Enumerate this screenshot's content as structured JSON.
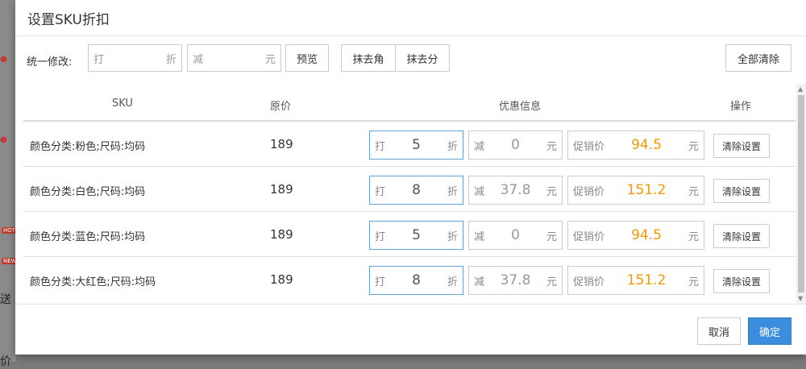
{
  "background": {
    "badge_hot": "HOT",
    "badge_new": "NEW",
    "text_song": "送",
    "text_jia": "价"
  },
  "modal": {
    "title": "设置SKU折扣"
  },
  "toolbar": {
    "label": "统一修改:",
    "discount_placeholder": "打",
    "discount_unit": "折",
    "reduce_placeholder": "减",
    "reduce_unit": "元",
    "preview_label": "预览",
    "round_jiao_label": "抹去角",
    "round_fen_label": "抹去分",
    "clear_all_label": "全部清除"
  },
  "table": {
    "headers": {
      "sku": "SKU",
      "price": "原价",
      "discount": "优惠信息",
      "ops": "操作"
    },
    "discount_prefix": "打",
    "discount_unit": "折",
    "reduce_prefix": "减",
    "reduce_unit": "元",
    "promo_prefix": "促销价",
    "promo_unit": "元",
    "clear_label": "清除设置",
    "rows": [
      {
        "sku": "颜色分类:粉色;尺码:均码",
        "price": "189",
        "discount": "5",
        "reduce": "0",
        "promo": "94.5"
      },
      {
        "sku": "颜色分类:白色;尺码:均码",
        "price": "189",
        "discount": "8",
        "reduce": "37.8",
        "promo": "151.2"
      },
      {
        "sku": "颜色分类:蓝色;尺码:均码",
        "price": "189",
        "discount": "5",
        "reduce": "0",
        "promo": "94.5"
      },
      {
        "sku": "颜色分类:大红色;尺码:均码",
        "price": "189",
        "discount": "8",
        "reduce": "37.8",
        "promo": "151.2"
      }
    ]
  },
  "footer": {
    "cancel_label": "取消",
    "confirm_label": "确定"
  },
  "colors": {
    "promo_price": "#f39800",
    "primary": "#3c8dde",
    "focus_border": "#66a3d2"
  }
}
